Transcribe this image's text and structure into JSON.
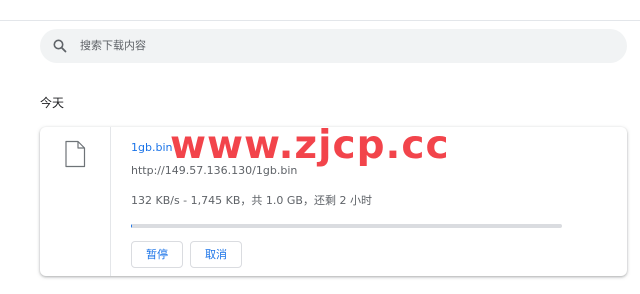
{
  "search": {
    "placeholder": "搜索下载内容"
  },
  "sections": [
    {
      "date_label": "今天",
      "downloads": [
        {
          "file_name": "1gb.bin",
          "url": "http://149.57.136.130/1gb.bin",
          "status": "132 KB/s - 1,745 KB，共 1.0 GB，还剩 2 小时",
          "progress_fraction": 0.0017,
          "pause_label": "暂停",
          "cancel_label": "取消"
        }
      ]
    }
  ],
  "watermark": {
    "text": "www.zjcp.cc"
  },
  "colors": {
    "accent": "#1a73e8",
    "watermark": "#f2444b",
    "search_bg": "#f1f3f4",
    "secondary_text": "#5f6368"
  }
}
